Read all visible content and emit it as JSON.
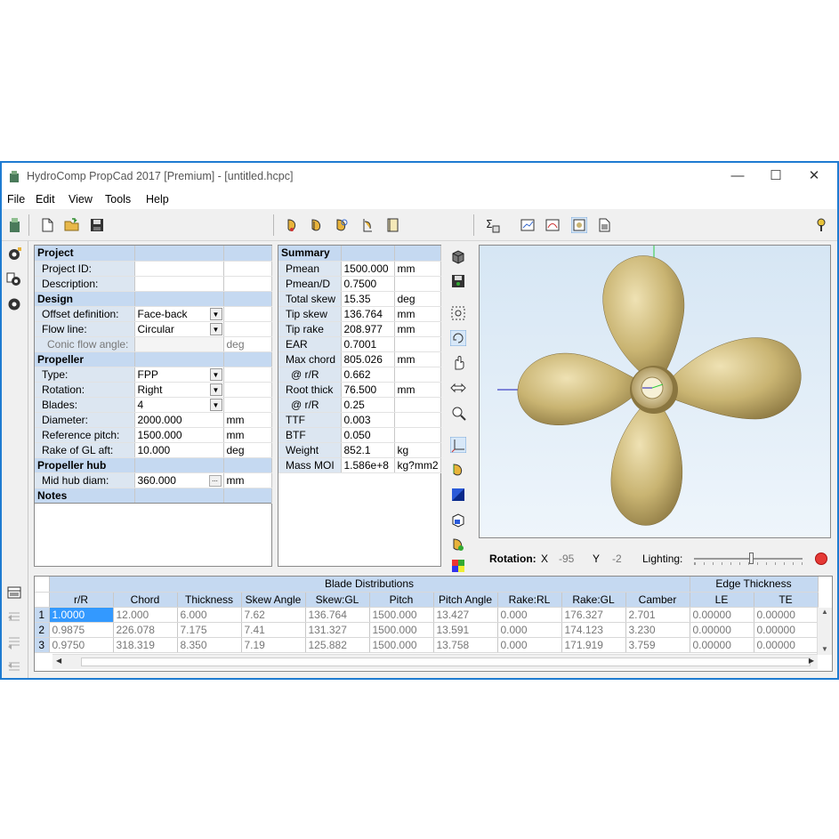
{
  "window": {
    "title": "HydroComp PropCad 2017 [Premium] - [untitled.hcpc]",
    "min": "—",
    "max": "☐",
    "close": "✕"
  },
  "menu": [
    "File",
    "Edit",
    "View",
    "Tools",
    "Help"
  ],
  "project": {
    "header": "Project",
    "id_label": "Project ID:",
    "id_value": "",
    "desc_label": "Description:",
    "desc_value": "",
    "design_header": "Design",
    "offset_label": "Offset definition:",
    "offset_value": "Face-back",
    "flow_label": "Flow line:",
    "flow_value": "Circular",
    "conic_label": "Conic flow angle:",
    "conic_unit": "deg",
    "propeller_header": "Propeller",
    "type_label": "Type:",
    "type_value": "FPP",
    "rotation_label": "Rotation:",
    "rotation_value": "Right",
    "blades_label": "Blades:",
    "blades_value": "4",
    "diameter_label": "Diameter:",
    "diameter_value": "2000.000",
    "diameter_unit": "mm",
    "refpitch_label": "Reference pitch:",
    "refpitch_value": "1500.000",
    "refpitch_unit": "mm",
    "rake_label": "Rake of GL aft:",
    "rake_value": "10.000",
    "rake_unit": "deg",
    "hub_header": "Propeller hub",
    "hub_label": "Mid hub diam:",
    "hub_value": "360.000",
    "hub_unit": "mm",
    "notes_header": "Notes"
  },
  "summary": {
    "header": "Summary",
    "rows": [
      {
        "label": "Pmean",
        "value": "1500.000",
        "unit": "mm"
      },
      {
        "label": "Pmean/D",
        "value": "0.7500",
        "unit": ""
      },
      {
        "label": "Total skew",
        "value": "15.35",
        "unit": "deg"
      },
      {
        "label": "Tip skew",
        "value": "136.764",
        "unit": "mm"
      },
      {
        "label": "Tip rake",
        "value": "208.977",
        "unit": "mm"
      },
      {
        "label": "EAR",
        "value": "0.7001",
        "unit": ""
      },
      {
        "label": "Max chord",
        "value": "805.026",
        "unit": "mm"
      },
      {
        "label": "@ r/R",
        "value": "0.662",
        "unit": ""
      },
      {
        "label": "Root thick",
        "value": "76.500",
        "unit": "mm"
      },
      {
        "label": "@ r/R",
        "value": "0.25",
        "unit": ""
      },
      {
        "label": "TTF",
        "value": "0.003",
        "unit": ""
      },
      {
        "label": "BTF",
        "value": "0.050",
        "unit": ""
      },
      {
        "label": "Weight",
        "value": "852.1",
        "unit": "kg"
      },
      {
        "label": "Mass MOI",
        "value": "1.586e+8",
        "unit": "kg?mm2"
      }
    ]
  },
  "rotation_bar": {
    "rotation_label": "Rotation:",
    "x_label": "X",
    "x_value": "-95",
    "y_label": "Y",
    "y_value": "-2",
    "lighting_label": "Lighting:"
  },
  "blade_table": {
    "group_header": "Blade Distributions",
    "edge_header": "Edge Thickness",
    "columns": [
      "r/R",
      "Chord",
      "Thickness",
      "Skew Angle",
      "Skew:GL",
      "Pitch",
      "Pitch Angle",
      "Rake:RL",
      "Rake:GL",
      "Camber",
      "LE",
      "TE"
    ],
    "rows": [
      {
        "n": "1",
        "cells": [
          "1.0000",
          "12.000",
          "6.000",
          "7.62",
          "136.764",
          "1500.000",
          "13.427",
          "0.000",
          "176.327",
          "2.701",
          "0.00000",
          "0.00000"
        ]
      },
      {
        "n": "2",
        "cells": [
          "0.9875",
          "226.078",
          "7.175",
          "7.41",
          "131.327",
          "1500.000",
          "13.591",
          "0.000",
          "174.123",
          "3.230",
          "0.00000",
          "0.00000"
        ]
      },
      {
        "n": "3",
        "cells": [
          "0.9750",
          "318.319",
          "8.350",
          "7.19",
          "125.882",
          "1500.000",
          "13.758",
          "0.000",
          "171.919",
          "3.759",
          "0.00000",
          "0.00000"
        ]
      }
    ]
  },
  "colors": {
    "accent": "#1e7bd1",
    "header_blue": "#c5d9f1",
    "label_blue": "#dce6f1",
    "propeller_gold": "#c9b472"
  }
}
